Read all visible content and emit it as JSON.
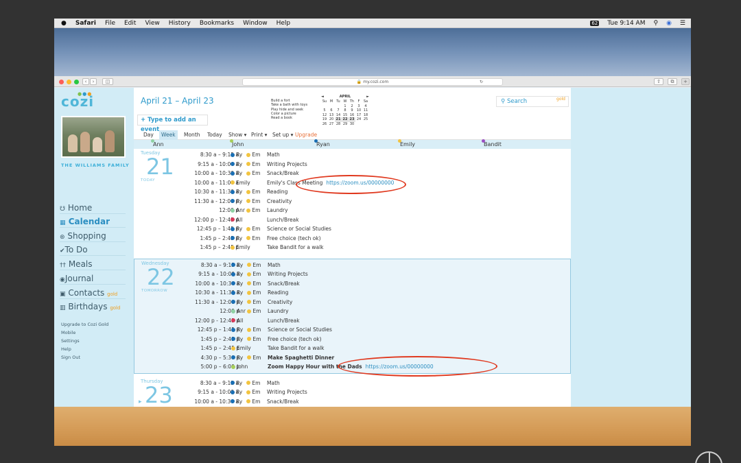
{
  "menubar": {
    "apple": "",
    "items": [
      "Safari",
      "File",
      "Edit",
      "View",
      "History",
      "Bookmarks",
      "Window",
      "Help"
    ],
    "battery": "62",
    "clock": "Tue 9:14 AM"
  },
  "browser": {
    "url": "my.cozi.com",
    "nav_back": "‹",
    "nav_forward": "›"
  },
  "sidebar": {
    "logo": "cozi",
    "family": "THE WILLIAMS FAMILY",
    "nav": [
      {
        "icon": "home-icon",
        "glyph": "⌂",
        "label": "Home"
      },
      {
        "icon": "calendar-icon",
        "glyph": "▦",
        "label": "Calendar"
      },
      {
        "icon": "cart-icon",
        "glyph": "⊞",
        "label": "Shopping"
      },
      {
        "icon": "check-icon",
        "glyph": "✔",
        "label": "To Do"
      },
      {
        "icon": "utensils-icon",
        "glyph": "ǂ",
        "label": "Meals"
      },
      {
        "icon": "camera-icon",
        "glyph": "◙",
        "label": "Journal"
      },
      {
        "icon": "contacts-icon",
        "glyph": "▣",
        "label": "Contacts"
      },
      {
        "icon": "gift-icon",
        "glyph": "▥",
        "label": "Birthdays"
      }
    ],
    "gold": "gold",
    "links": [
      "Upgrade to Cozi Gold",
      "Mobile",
      "Settings",
      "Help",
      "Sign Out"
    ]
  },
  "header": {
    "date_range": "April 21 – April 23",
    "add_event": "+ Type to add an event",
    "tasks": [
      "Build a fort",
      "Take a bath with toys",
      "Play hide and seek",
      "Color a picture",
      "Read a book"
    ],
    "search": "Search",
    "gold": "gold"
  },
  "mini_cal": {
    "month": "APRIL",
    "prev": "◄",
    "next": "►",
    "dow": [
      "Su",
      "M",
      "Tu",
      "W",
      "Th",
      "F",
      "Sa"
    ],
    "weeks": [
      [
        "",
        "",
        "",
        "1",
        "2",
        "3",
        "4"
      ],
      [
        "5",
        "6",
        "7",
        "8",
        "9",
        "10",
        "11"
      ],
      [
        "12",
        "13",
        "14",
        "15",
        "16",
        "17",
        "18"
      ],
      [
        "19",
        "20",
        "21",
        "22",
        "23",
        "24",
        "25"
      ],
      [
        "26",
        "27",
        "28",
        "29",
        "30",
        "",
        ""
      ]
    ],
    "bold_days": [
      "21",
      "22",
      "23"
    ]
  },
  "toolbar": {
    "day": "Day",
    "week": "Week",
    "month": "Month",
    "today": "Today",
    "show": "Show ▾",
    "print": "Print ▾",
    "setup": "Set up ▾",
    "upgrade": "Upgrade"
  },
  "people": [
    {
      "name": "Ann",
      "color": "#8fd1a4"
    },
    {
      "name": "John",
      "color": "#a7cf5a"
    },
    {
      "name": "Ryan",
      "color": "#1a6fb4"
    },
    {
      "name": "Emily",
      "color": "#f2c440"
    },
    {
      "name": "Bandit",
      "color": "#9b4fc4"
    }
  ],
  "days": [
    {
      "name": "Tuesday",
      "num": "21",
      "sub": "TODAY",
      "events": [
        {
          "time": "8:30 a – 9:15 a",
          "who": "RE",
          "subject": "Math"
        },
        {
          "time": "9:15 a - 10:00 a",
          "who": "RE",
          "subject": "Writing Projects"
        },
        {
          "time": "10:00 a - 10:30 a",
          "who": "RE",
          "subject": "Snack/Break"
        },
        {
          "time": "10:00 a - 11:00 a",
          "who": "Emily",
          "subject": "Emily's Class Meeting",
          "link": "https://zoom.us/00000000"
        },
        {
          "time": "10:30 a - 11:30 a",
          "who": "RE",
          "subject": "Reading"
        },
        {
          "time": "11:30 a - 12:00 p",
          "who": "RE",
          "subject": "Creativity"
        },
        {
          "time": "12:00 p",
          "who": "AE",
          "subject": "Laundry"
        },
        {
          "time": "12:00 p - 12:45 p",
          "who": "All",
          "subject": "Lunch/Break"
        },
        {
          "time": "12:45 p – 1:45 p",
          "who": "RE",
          "subject": "Science or Social Studies"
        },
        {
          "time": "1:45 p – 2:45 p",
          "who": "RE",
          "subject": "Free choice (tech ok)"
        },
        {
          "time": "1:45 p – 2:45 p",
          "who": "Emily",
          "subject": "Take Bandit for a walk"
        }
      ]
    },
    {
      "name": "Wednesday",
      "num": "22",
      "sub": "TOMORROW",
      "events": [
        {
          "time": "8:30 a – 9:15 a",
          "who": "RE",
          "subject": "Math"
        },
        {
          "time": "9:15 a - 10:00 a",
          "who": "RE",
          "subject": "Writing Projects"
        },
        {
          "time": "10:00 a - 10:30 a",
          "who": "RE",
          "subject": "Snack/Break"
        },
        {
          "time": "10:30 a - 11:30 a",
          "who": "RE",
          "subject": "Reading"
        },
        {
          "time": "11:30 a - 12:00 p",
          "who": "RE",
          "subject": "Creativity"
        },
        {
          "time": "12:00 p",
          "who": "AE",
          "subject": "Laundry"
        },
        {
          "time": "12:00 p - 12:45 p",
          "who": "All",
          "subject": "Lunch/Break"
        },
        {
          "time": "12:45 p – 1:45 p",
          "who": "RE",
          "subject": "Science or Social Studies"
        },
        {
          "time": "1:45 p – 2:45 p",
          "who": "RE",
          "subject": "Free choice (tech ok)"
        },
        {
          "time": "1:45 p – 2:45 p",
          "who": "Emily",
          "subject": "Take Bandit for a walk"
        },
        {
          "time": "4:30 p – 5:30 p",
          "who": "RE",
          "subject": "Make Spaghetti Dinner",
          "bold": true
        },
        {
          "time": "5:00 p – 6:00 p",
          "who": "John",
          "subject": "Zoom Happy Hour with the Dads",
          "bold": true,
          "link": "https://zoom.us/00000000"
        }
      ]
    },
    {
      "name": "Thursday",
      "num": "23",
      "sub": "",
      "events": [
        {
          "time": "8:30 a – 9:15 a",
          "who": "RE",
          "subject": "Math"
        },
        {
          "time": "9:15 a - 10:00 a",
          "who": "RE",
          "subject": "Writing Projects"
        },
        {
          "time": "10:00 a - 10:30 a",
          "who": "RE",
          "subject": "Snack/Break"
        }
      ]
    }
  ],
  "who_labels": {
    "ryan": "Ry",
    "em": "Em",
    "ann": "Ann",
    "emily": "Emily",
    "all": "All",
    "john": "John"
  },
  "colors": {
    "accent": "#2e9acb",
    "annotation": "#e0391f",
    "all_dot": "#d93a5a"
  }
}
